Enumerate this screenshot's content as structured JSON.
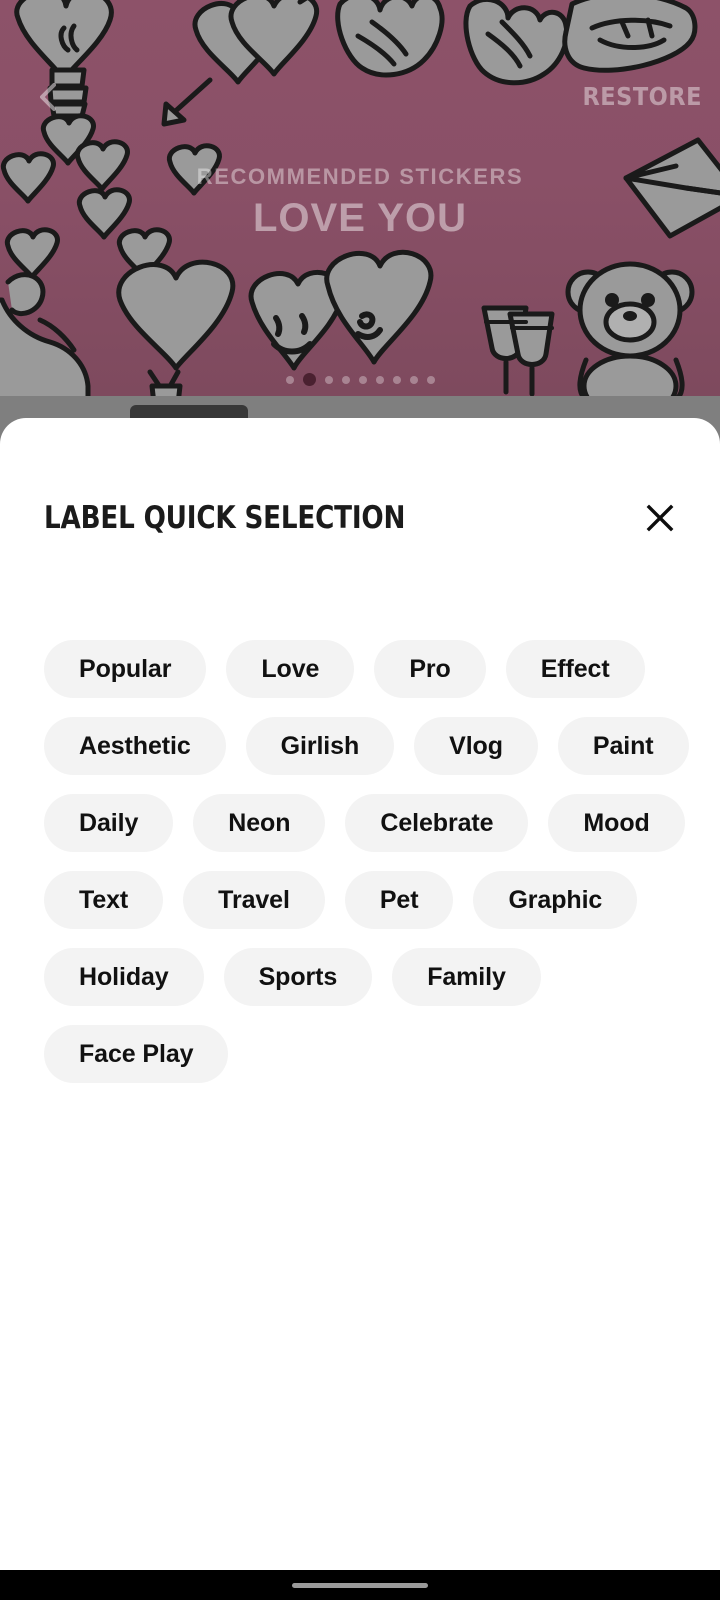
{
  "banner": {
    "kicker": "RECOMMENDED STICKERS",
    "title": "LOVE YOU",
    "restore_label": "RESTORE",
    "back_icon": "chevron-left-icon",
    "accent_color": "#8a5067",
    "pager": {
      "total": 9,
      "active_index": 1
    }
  },
  "sheet": {
    "title": "LABEL QUICK SELECTION",
    "close_icon": "close-icon",
    "background_color": "#ffffff",
    "chip_background_color": "#f3f3f3",
    "chip_text_color": "#111111",
    "chips": [
      "Popular",
      "Love",
      "Pro",
      "Effect",
      "Aesthetic",
      "Girlish",
      "Vlog",
      "Paint",
      "Daily",
      "Neon",
      "Celebrate",
      "Mood",
      "Text",
      "Travel",
      "Pet",
      "Graphic",
      "Holiday",
      "Sports",
      "Family",
      "Face Play"
    ]
  },
  "system": {
    "navbar_color": "#000000",
    "home_indicator_color": "#9a9a9a"
  }
}
